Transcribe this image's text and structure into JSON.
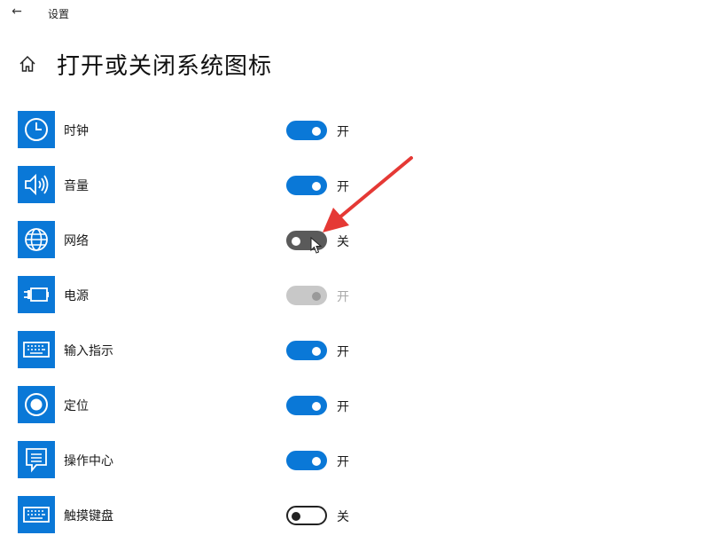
{
  "window": {
    "back_glyph": "←",
    "app_title": "设置"
  },
  "page": {
    "title": "打开或关闭系统图标"
  },
  "colors": {
    "accent": "#0a78d7",
    "annotation_arrow": "#e53935"
  },
  "items": [
    {
      "icon": "clock-icon",
      "label": "时钟",
      "state_label": "开",
      "state": "on"
    },
    {
      "icon": "volume-icon",
      "label": "音量",
      "state_label": "开",
      "state": "on"
    },
    {
      "icon": "globe-network-icon",
      "label": "网络",
      "state_label": "关",
      "state": "off-hover"
    },
    {
      "icon": "battery-plug-icon",
      "label": "电源",
      "state_label": "开",
      "state": "disabled"
    },
    {
      "icon": "keyboard-icon",
      "label": "输入指示",
      "state_label": "开",
      "state": "on"
    },
    {
      "icon": "location-icon",
      "label": "定位",
      "state_label": "开",
      "state": "on"
    },
    {
      "icon": "action-center-icon",
      "label": "操作中心",
      "state_label": "开",
      "state": "on"
    },
    {
      "icon": "touch-keyboard-icon",
      "label": "触摸键盘",
      "state_label": "关",
      "state": "off"
    }
  ]
}
